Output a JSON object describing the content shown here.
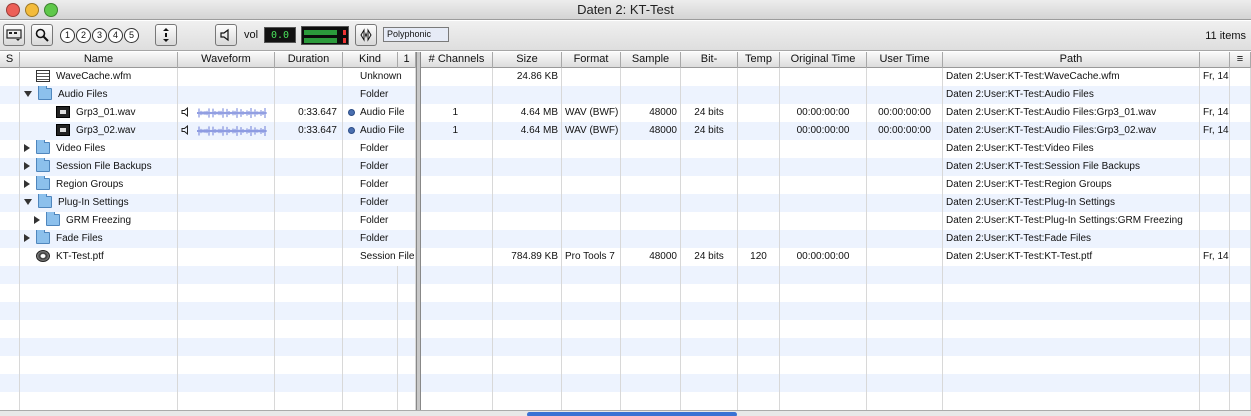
{
  "window": {
    "title": "Daten 2: KT-Test",
    "items_count": "11 items"
  },
  "toolbar": {
    "numbers": [
      "1",
      "2",
      "3",
      "4",
      "5"
    ],
    "vol_label": "vol",
    "vol_value": "0.0",
    "mode": "Polyphonic",
    "meter_levels": [
      0.82,
      0.82
    ]
  },
  "left_columns": [
    "S",
    "Name",
    "Waveform",
    "Duration",
    "Kind",
    "1"
  ],
  "right_columns": [
    "# Channels",
    "Size",
    "Format",
    "Sample",
    "Bit-",
    "Temp",
    "Original Time",
    "User Time",
    "Path",
    ""
  ],
  "rows": [
    {
      "indent": 0,
      "disclosure": "none",
      "icon": "doc",
      "name": "WaveCache.wfm",
      "waveform": false,
      "duration": "",
      "kind": "Unknown",
      "channels": "",
      "size": "24.86 KB",
      "format": "",
      "sample": "",
      "bit": "",
      "temp": "",
      "orig_time": "",
      "user_time": "",
      "path": "Daten 2:User:KT-Test:WaveCache.wfm",
      "extra": "Fr, 14."
    },
    {
      "indent": 0,
      "disclosure": "open",
      "icon": "folder",
      "name": "Audio Files",
      "waveform": false,
      "duration": "",
      "kind": "Folder",
      "channels": "",
      "size": "",
      "format": "",
      "sample": "",
      "bit": "",
      "temp": "",
      "orig_time": "",
      "user_time": "",
      "path": "Daten 2:User:KT-Test:Audio Files",
      "extra": ""
    },
    {
      "indent": 2,
      "disclosure": "none",
      "icon": "film",
      "name": "Grp3_01.wav",
      "waveform": true,
      "duration": "0:33.647",
      "kind": "Audio File",
      "channels": "1",
      "size": "4.64 MB",
      "format": "WAV (BWF)",
      "sample": "48000",
      "bit": "24 bits",
      "temp": "",
      "orig_time": "00:00:00:00",
      "user_time": "00:00:00:00",
      "path": "Daten 2:User:KT-Test:Audio Files:Grp3_01.wav",
      "extra": "Fr, 14."
    },
    {
      "indent": 2,
      "disclosure": "none",
      "icon": "film",
      "name": "Grp3_02.wav",
      "waveform": true,
      "duration": "0:33.647",
      "kind": "Audio File",
      "channels": "1",
      "size": "4.64 MB",
      "format": "WAV (BWF)",
      "sample": "48000",
      "bit": "24 bits",
      "temp": "",
      "orig_time": "00:00:00:00",
      "user_time": "00:00:00:00",
      "path": "Daten 2:User:KT-Test:Audio Files:Grp3_02.wav",
      "extra": "Fr, 14."
    },
    {
      "indent": 0,
      "disclosure": "closed",
      "icon": "folder",
      "name": "Video Files",
      "waveform": false,
      "duration": "",
      "kind": "Folder",
      "channels": "",
      "size": "",
      "format": "",
      "sample": "",
      "bit": "",
      "temp": "",
      "orig_time": "",
      "user_time": "",
      "path": "Daten 2:User:KT-Test:Video Files",
      "extra": ""
    },
    {
      "indent": 0,
      "disclosure": "closed",
      "icon": "folder",
      "name": "Session File Backups",
      "waveform": false,
      "duration": "",
      "kind": "Folder",
      "channels": "",
      "size": "",
      "format": "",
      "sample": "",
      "bit": "",
      "temp": "",
      "orig_time": "",
      "user_time": "",
      "path": "Daten 2:User:KT-Test:Session File Backups",
      "extra": ""
    },
    {
      "indent": 0,
      "disclosure": "closed",
      "icon": "folder",
      "name": "Region Groups",
      "waveform": false,
      "duration": "",
      "kind": "Folder",
      "channels": "",
      "size": "",
      "format": "",
      "sample": "",
      "bit": "",
      "temp": "",
      "orig_time": "",
      "user_time": "",
      "path": "Daten 2:User:KT-Test:Region Groups",
      "extra": ""
    },
    {
      "indent": 0,
      "disclosure": "open",
      "icon": "folder",
      "name": "Plug-In Settings",
      "waveform": false,
      "duration": "",
      "kind": "Folder",
      "channels": "",
      "size": "",
      "format": "",
      "sample": "",
      "bit": "",
      "temp": "",
      "orig_time": "",
      "user_time": "",
      "path": "Daten 2:User:KT-Test:Plug-In Settings",
      "extra": ""
    },
    {
      "indent": 1,
      "disclosure": "closed",
      "icon": "folder",
      "name": "GRM Freezing",
      "waveform": false,
      "duration": "",
      "kind": "Folder",
      "channels": "",
      "size": "",
      "format": "",
      "sample": "",
      "bit": "",
      "temp": "",
      "orig_time": "",
      "user_time": "",
      "path": "Daten 2:User:KT-Test:Plug-In Settings:GRM Freezing",
      "extra": ""
    },
    {
      "indent": 0,
      "disclosure": "closed",
      "icon": "folder",
      "name": "Fade Files",
      "waveform": false,
      "duration": "",
      "kind": "Folder",
      "channels": "",
      "size": "",
      "format": "",
      "sample": "",
      "bit": "",
      "temp": "",
      "orig_time": "",
      "user_time": "",
      "path": "Daten 2:User:KT-Test:Fade Files",
      "extra": ""
    },
    {
      "indent": 0,
      "disclosure": "none",
      "icon": "session",
      "name": "KT-Test.ptf",
      "waveform": false,
      "duration": "",
      "kind": "Session File",
      "channels": "",
      "size": "784.89 KB",
      "format": "Pro Tools 7",
      "sample": "48000",
      "bit": "24 bits",
      "temp": "120",
      "orig_time": "00:00:00:00",
      "user_time": "",
      "path": "Daten 2:User:KT-Test:KT-Test.ptf",
      "extra": "Fr, 14."
    }
  ],
  "empty_rows": 8,
  "colors": {
    "stripe": "#edf3fe",
    "folder": "#8cc0ec",
    "meter_green": "#2b9a3b",
    "lcd_text": "#49e05a"
  }
}
